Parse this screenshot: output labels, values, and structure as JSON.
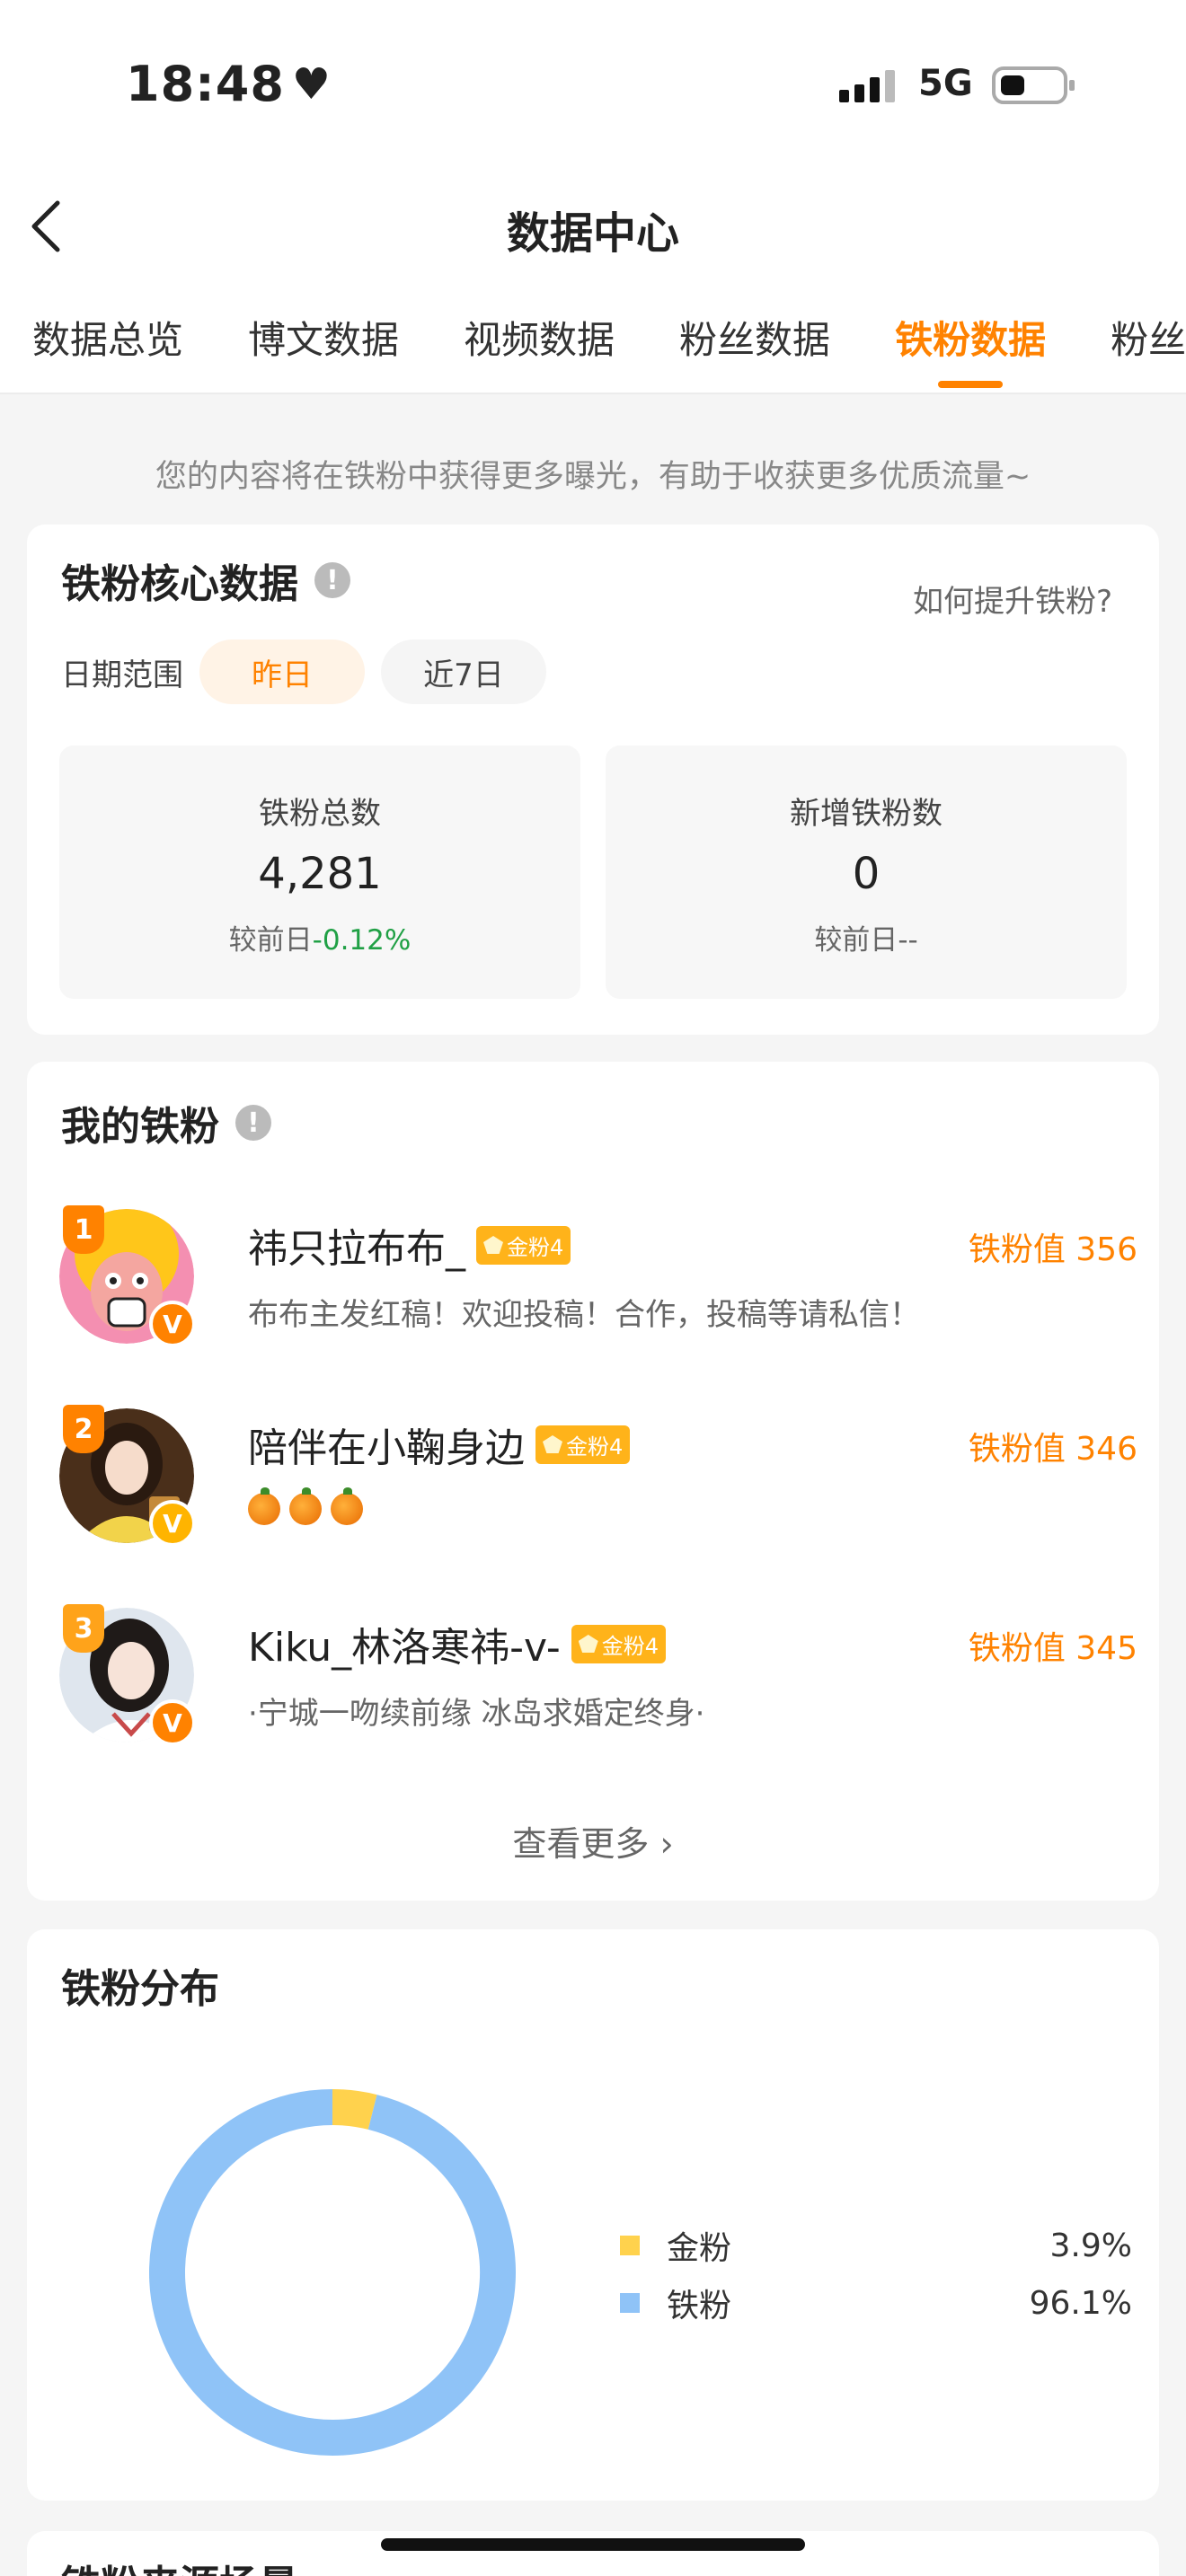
{
  "status": {
    "time": "18:48",
    "network": "5G"
  },
  "nav": {
    "title": "数据中心"
  },
  "tabs": [
    {
      "label": "数据总览",
      "active": false
    },
    {
      "label": "博文数据",
      "active": false
    },
    {
      "label": "视频数据",
      "active": false
    },
    {
      "label": "粉丝数据",
      "active": false
    },
    {
      "label": "铁粉数据",
      "active": true
    },
    {
      "label": "粉丝",
      "active": false
    }
  ],
  "tip": "您的内容将在铁粉中获得更多曝光，有助于收获更多优质流量~",
  "core": {
    "title": "铁粉核心数据",
    "help_link": "如何提升铁粉?",
    "date_label": "日期范围",
    "date_options": [
      "昨日",
      "近7日"
    ],
    "stats": [
      {
        "label": "铁粉总数",
        "value": "4,281",
        "compare_label": "较前日",
        "change": "-0.12%"
      },
      {
        "label": "新增铁粉数",
        "value": "0",
        "compare_label": "较前日",
        "change": "--"
      }
    ]
  },
  "my_fans": {
    "title": "我的铁粉",
    "badge_text": "金粉4",
    "value_prefix": "铁粉值",
    "items": [
      {
        "rank": "1",
        "name": "祎只拉布布_",
        "desc": "布布主发红稿！欢迎投稿！合作，投稿等请私信！",
        "value": "356"
      },
      {
        "rank": "2",
        "name": "陪伴在小鞠身边",
        "desc": "",
        "value": "346"
      },
      {
        "rank": "3",
        "name": "Kiku_林洛寒祎-v-",
        "desc": "·宁城一吻续前缘 冰岛求婚定终身·",
        "value": "345"
      }
    ],
    "more": "查看更多 ›"
  },
  "distribution": {
    "title": "铁粉分布",
    "legend": [
      {
        "name": "金粉",
        "pct": "3.9%",
        "color": "#ffd24d"
      },
      {
        "name": "铁粉",
        "pct": "96.1%",
        "color": "#8fc3f7"
      }
    ]
  },
  "next_section": {
    "title": "铁粉来源场景"
  },
  "chart_data": {
    "type": "pie",
    "categories": [
      "金粉",
      "铁粉"
    ],
    "values": [
      3.9,
      96.1
    ],
    "colors": [
      "#ffd24d",
      "#8fc3f7"
    ]
  }
}
